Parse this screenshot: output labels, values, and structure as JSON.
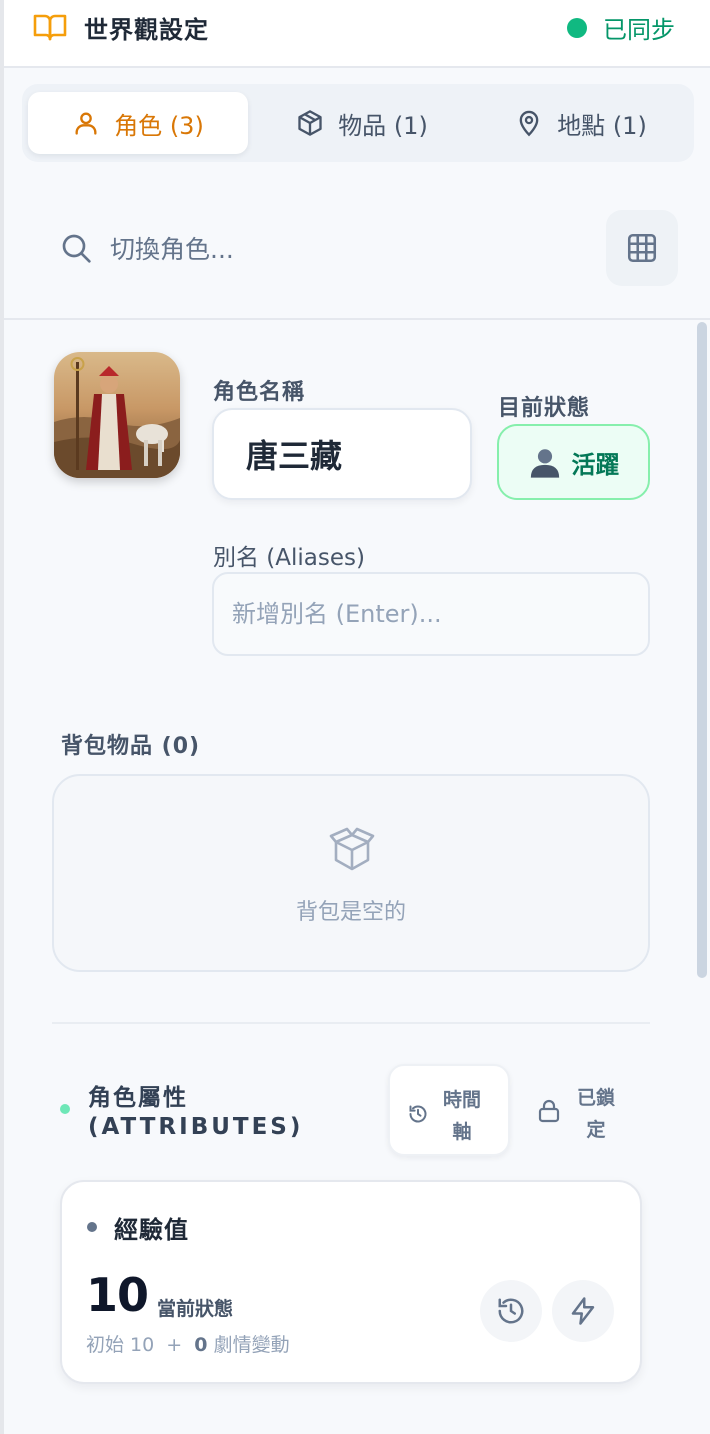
{
  "header": {
    "title": "世界觀設定",
    "sync_status": "已同步",
    "icon": "book-icon",
    "colors": {
      "accent": "#d97706",
      "sync": "#10b981"
    }
  },
  "tabs": [
    {
      "label": "角色 (3)",
      "icon": "user-icon",
      "active": true
    },
    {
      "label": "物品 (1)",
      "icon": "box-icon",
      "active": false
    },
    {
      "label": "地點 (1)",
      "icon": "map-pin-icon",
      "active": false
    }
  ],
  "search": {
    "placeholder": "切換角色...",
    "icon": "search-icon",
    "grid_icon": "grid-icon"
  },
  "character": {
    "avatar_icon": "character-portrait",
    "name_label": "角色名稱",
    "name_value": "唐三藏",
    "status_label": "目前狀態",
    "status_value": "活躍",
    "alias_label": "別名 (Aliases)",
    "alias_placeholder": "新增別名 (Enter)..."
  },
  "inventory": {
    "label": "背包物品 (0)",
    "empty_text": "背包是空的",
    "icon": "package-icon"
  },
  "attributes": {
    "title_line1": "角色屬性",
    "title_line2": "(ATTRIBUTES)",
    "timeline_line1": "時間",
    "timeline_line2": "軸",
    "lock_line1": "已鎖",
    "lock_line2": "定",
    "items": [
      {
        "name": "經驗值",
        "value": "10",
        "state_label": "當前狀態",
        "base_prefix": "初始 10  +  ",
        "delta": "0",
        "delta_suffix": " 劇情變動"
      }
    ]
  }
}
